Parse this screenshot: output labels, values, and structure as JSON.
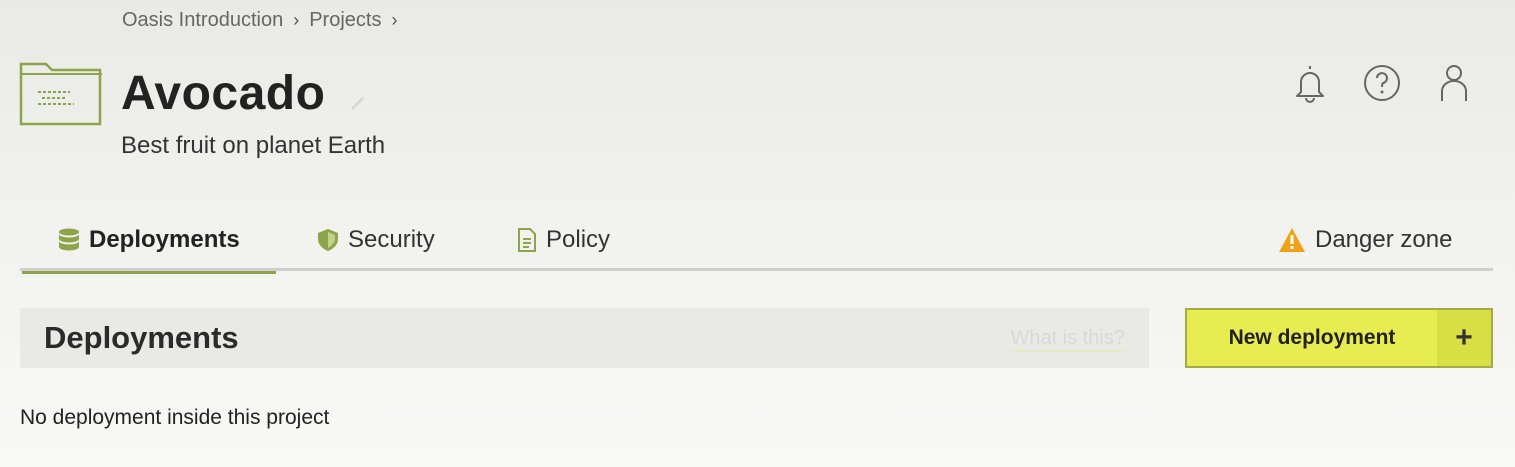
{
  "breadcrumb": {
    "items": [
      "Oasis Introduction",
      "Projects"
    ],
    "separator": "›"
  },
  "project": {
    "title": "Avocado",
    "subtitle": "Best fruit on planet Earth"
  },
  "header_icons": [
    "bell-icon",
    "help-icon",
    "user-icon"
  ],
  "tabs": [
    {
      "label": "Deployments",
      "icon": "database-icon",
      "active": true
    },
    {
      "label": "Security",
      "icon": "shield-icon",
      "active": false
    },
    {
      "label": "Policy",
      "icon": "document-icon",
      "active": false
    },
    {
      "label": "Danger zone",
      "icon": "warning-icon",
      "active": false
    }
  ],
  "section": {
    "title": "Deployments",
    "help_link": "What is this?",
    "new_button_label": "New deployment",
    "new_button_icon": "+"
  },
  "empty_message": "No deployment inside this project",
  "colors": {
    "accent": "#8ea44a",
    "button": "#e7ec50",
    "warning": "#f0a11a"
  }
}
